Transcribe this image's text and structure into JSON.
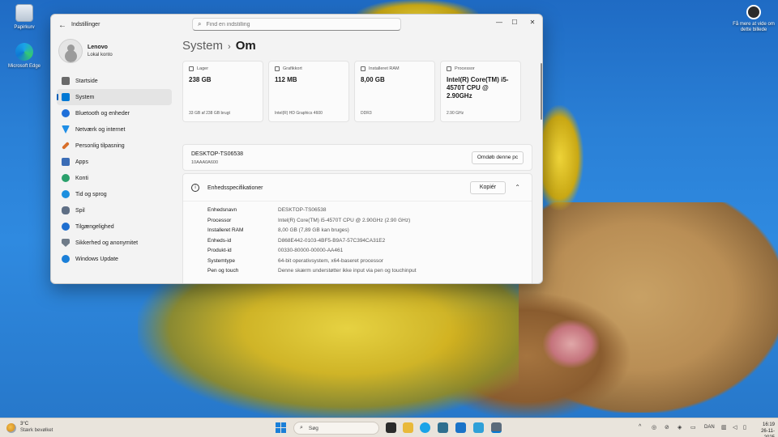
{
  "desktop": {
    "icons": [
      {
        "label": "Papirkurv"
      },
      {
        "label": "Microsoft Edge"
      }
    ],
    "spotlight": {
      "label": "Få mere at vide om dette billede"
    }
  },
  "window": {
    "title": "Indstillinger",
    "search_placeholder": "Find en indstilling",
    "controls": {
      "minimize": "—",
      "maximize": "☐",
      "close": "✕"
    }
  },
  "profile": {
    "name": "Lenovo",
    "type": "Lokal konto"
  },
  "sidebar": {
    "items": [
      {
        "label": "Startside",
        "color": "#6a6a6a"
      },
      {
        "label": "System",
        "color": "#0078d4"
      },
      {
        "label": "Bluetooth og enheder",
        "color": "#1e6fd9"
      },
      {
        "label": "Netværk og internet",
        "color": "#1f8ee6"
      },
      {
        "label": "Personlig tilpasning",
        "color": "#d86f2a"
      },
      {
        "label": "Apps",
        "color": "#3b6db6"
      },
      {
        "label": "Konti",
        "color": "#2aa06b"
      },
      {
        "label": "Tid og sprog",
        "color": "#1c8fdf"
      },
      {
        "label": "Spil",
        "color": "#5f6f85"
      },
      {
        "label": "Tilgængelighed",
        "color": "#1f6fd0"
      },
      {
        "label": "Sikkerhed og anonymitet",
        "color": "#6f7b88"
      },
      {
        "label": "Windows Update",
        "color": "#1a7fd8"
      }
    ],
    "active_index": 1
  },
  "breadcrumb": {
    "parent": "System",
    "separator": "›",
    "current": "Om"
  },
  "cards": [
    {
      "title": "Lager",
      "value": "238 GB",
      "sub": "33 GB af 238 GB brugt"
    },
    {
      "title": "Grafikkort",
      "value": "112 MB",
      "sub": "Intel(R) HD Graphics 4600"
    },
    {
      "title": "Installeret RAM",
      "value": "8,00 GB",
      "sub": "DDR3"
    },
    {
      "title": "Processor",
      "value": "Intel(R) Core(TM) i5-4570T CPU @ 2.90GHz",
      "sub": "2.90 GHz"
    }
  ],
  "device": {
    "name": "DESKTOP-TS06538",
    "model": "10AAA0A600",
    "rename_label": "Omdøb denne pc"
  },
  "specs": {
    "title": "Enhedsspecifikationer",
    "copy_label": "Kopiér",
    "rows": [
      {
        "label": "Enhedsnavn",
        "value": "DESKTOP-TS06538"
      },
      {
        "label": "Processor",
        "value": "Intel(R) Core(TM) i5-4570T CPU @ 2.90GHz (2.90 GHz)"
      },
      {
        "label": "Installeret RAM",
        "value": "8,00 GB (7,89 GB kan bruges)"
      },
      {
        "label": "Enheds-id",
        "value": "D868E442-0103-4BF5-B9A7-57C394CA31E2"
      },
      {
        "label": "Produkt-id",
        "value": "00330-80000-00000-AA461"
      },
      {
        "label": "Systemtype",
        "value": "64-bit operativsystem, x64-baseret processor"
      },
      {
        "label": "Pen og touch",
        "value": "Denne skærm understøtter ikke input via pen og touchinput"
      }
    ]
  },
  "taskbar": {
    "weather": {
      "temp": "3°C",
      "condition": "Stærk bevølket"
    },
    "search_label": "Søg",
    "language": "DAN",
    "time": "16:19",
    "date": "26-11-2025"
  }
}
